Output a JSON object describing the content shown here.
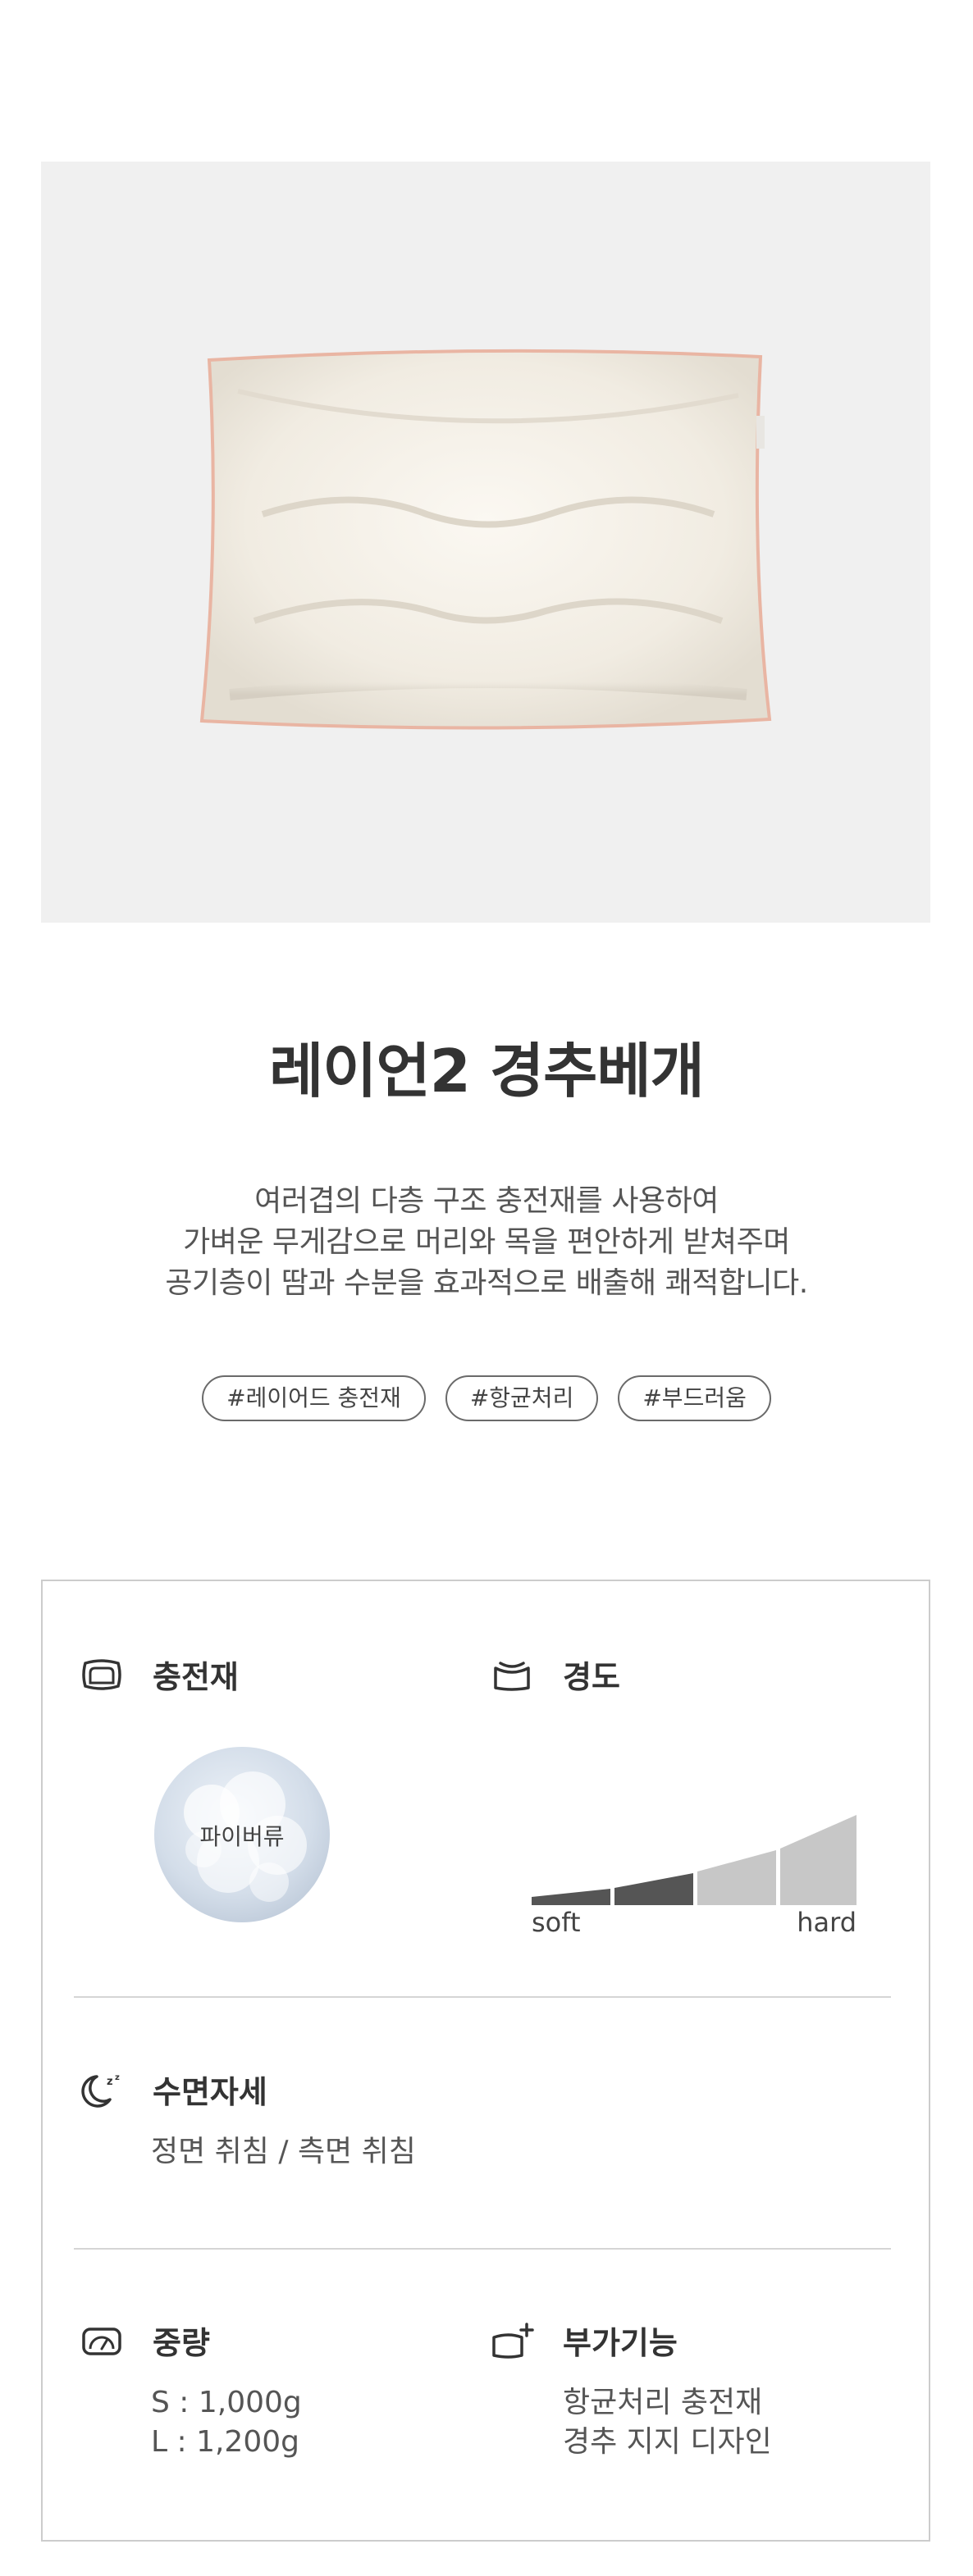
{
  "product": {
    "title": "레이언2 경추베개",
    "description": [
      "여러겹의 다층 구조 충전재를 사용하여",
      "가벼운 무게감으로 머리와 목을 편안하게 받쳐주며",
      "공기층이 땀과 수분을 효과적으로 배출해 쾌적합니다."
    ],
    "tags": [
      "#레이어드 충전재",
      "#항균처리",
      "#부드러움"
    ],
    "image_alt": "pillow-photo"
  },
  "specs": {
    "filler": {
      "title": "충전재",
      "icon": "pillow-icon",
      "material_label": "파이버류"
    },
    "hardness": {
      "title": "경도",
      "icon": "pillow-soft-icon",
      "low_label": "soft",
      "high_label": "hard",
      "levels": 4,
      "selected_level": 2,
      "active_color": "#555555",
      "inactive_color": "#c7c7c7"
    },
    "sleep_position": {
      "title": "수면자세",
      "icon": "moon-sleep-icon",
      "value": "정면 취침 / 측면 취침"
    },
    "weight": {
      "title": "중량",
      "icon": "scale-icon",
      "values": [
        "S : 1,000g",
        "L : 1,200g"
      ]
    },
    "extra": {
      "title": "부가기능",
      "icon": "pillow-plus-icon",
      "values": [
        "항균처리 충전재",
        "경추 지지 디자인"
      ]
    }
  }
}
